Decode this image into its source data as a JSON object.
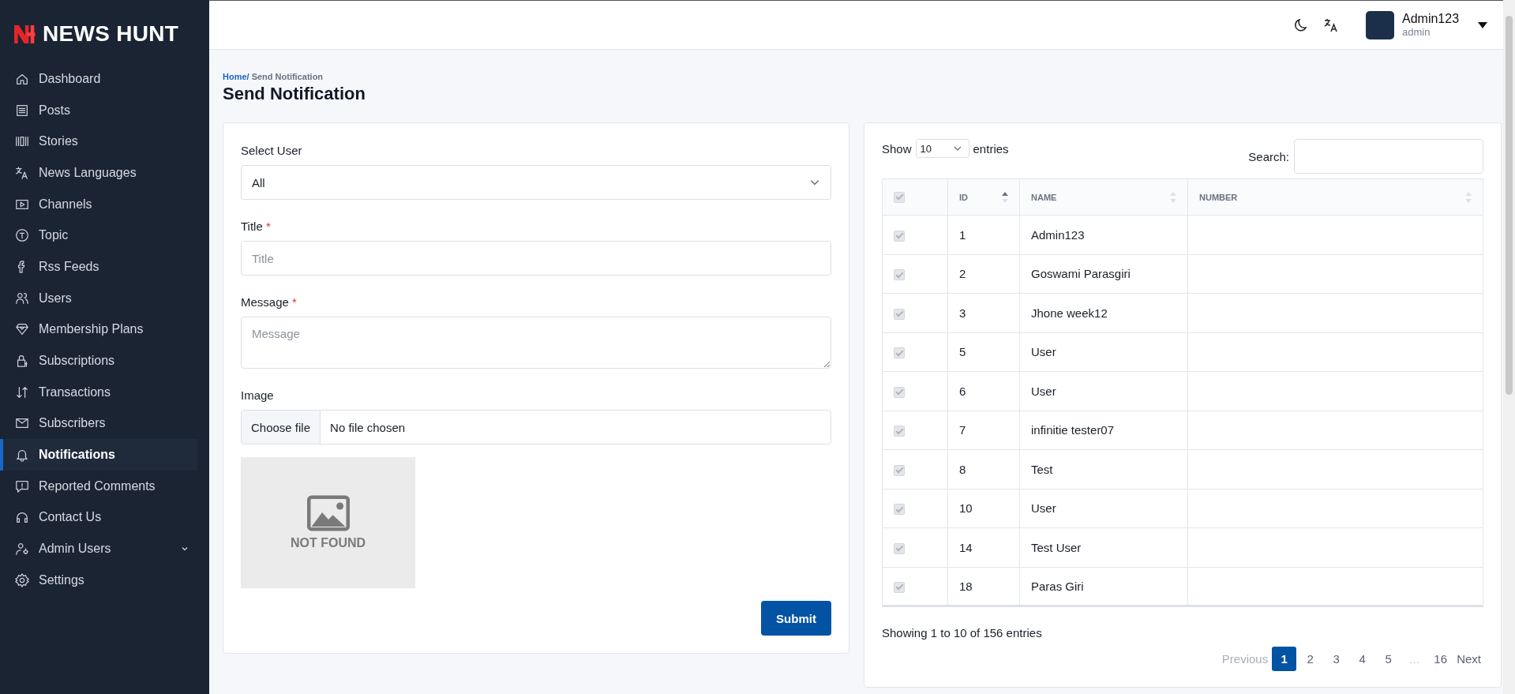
{
  "sidebar": {
    "brand": "NEWS HUNT",
    "items": [
      {
        "label": "Dashboard",
        "kind": "link",
        "selected": false
      },
      {
        "label": "Posts",
        "kind": "link",
        "selected": false
      },
      {
        "label": "Stories",
        "kind": "link",
        "selected": false
      },
      {
        "label": "News Languages",
        "kind": "link",
        "selected": false
      },
      {
        "label": "Channels",
        "kind": "link",
        "selected": false
      },
      {
        "label": "Topic",
        "kind": "link",
        "selected": false
      },
      {
        "label": "Rss Feeds",
        "kind": "link",
        "selected": false
      },
      {
        "label": "Users",
        "kind": "link",
        "selected": false
      },
      {
        "label": "Membership Plans",
        "kind": "link",
        "selected": false
      },
      {
        "label": "Subscriptions",
        "kind": "link",
        "selected": false
      },
      {
        "label": "Transactions",
        "kind": "link",
        "selected": false
      },
      {
        "label": "Subscribers",
        "kind": "link",
        "selected": false
      },
      {
        "label": "Notifications",
        "kind": "link",
        "selected": true
      },
      {
        "label": "Reported Comments",
        "kind": "link",
        "selected": false
      },
      {
        "label": "Contact Us",
        "kind": "link",
        "selected": false
      },
      {
        "label": "Admin Users",
        "kind": "group",
        "selected": false
      },
      {
        "label": "Settings",
        "kind": "link",
        "selected": false
      }
    ]
  },
  "header": {
    "user_name": "Admin123",
    "user_role": "admin"
  },
  "breadcrumb": {
    "home": "Home/",
    "current": "Send Notification"
  },
  "page_title": "Send Notification",
  "form": {
    "select_label": "Select User",
    "select_value": "All",
    "title_label": "Title",
    "title_required_mark": "*",
    "title_placeholder": "Title",
    "message_label": "Message",
    "message_required_mark": "*",
    "message_placeholder": "Message",
    "image_label": "Image",
    "file_button": "Choose file",
    "file_status": "No file chosen",
    "preview_text": "NOT FOUND",
    "submit": "Submit"
  },
  "table": {
    "show": "Show",
    "page_size": "10",
    "entries": "entries",
    "search_label": "Search:",
    "header_checked": true,
    "columns": [
      {
        "label": "ID",
        "sorted": true
      },
      {
        "label": "NAME",
        "sorted": false
      },
      {
        "label": "NUMBER",
        "sorted": false
      }
    ],
    "rows": [
      {
        "checked": true,
        "id": "1",
        "name": "Admin123"
      },
      {
        "checked": true,
        "id": "2",
        "name": "Goswami Parasgiri"
      },
      {
        "checked": true,
        "id": "3",
        "name": "Jhone week12"
      },
      {
        "checked": true,
        "id": "5",
        "name": "User"
      },
      {
        "checked": true,
        "id": "6",
        "name": "User"
      },
      {
        "checked": true,
        "id": "7",
        "name": "infinitie tester07"
      },
      {
        "checked": true,
        "id": "8",
        "name": "Test"
      },
      {
        "checked": true,
        "id": "10",
        "name": "User"
      },
      {
        "checked": true,
        "id": "14",
        "name": "Test User"
      },
      {
        "checked": true,
        "id": "18",
        "name": "Paras Giri"
      }
    ],
    "info": "Showing 1 to 10 of 156 entries",
    "previous": {
      "label": "Previous",
      "disabled": true
    },
    "pages": [
      {
        "label": "1",
        "kind": "page",
        "selected": true
      },
      {
        "label": "2",
        "kind": "page",
        "selected": false
      },
      {
        "label": "3",
        "kind": "page",
        "selected": false
      },
      {
        "label": "4",
        "kind": "page",
        "selected": false
      },
      {
        "label": "5",
        "kind": "page",
        "selected": false
      },
      {
        "label": "…",
        "kind": "ellipsis",
        "selected": false
      },
      {
        "label": "16",
        "kind": "page",
        "selected": false
      }
    ],
    "next": {
      "label": "Next",
      "disabled": false
    }
  }
}
